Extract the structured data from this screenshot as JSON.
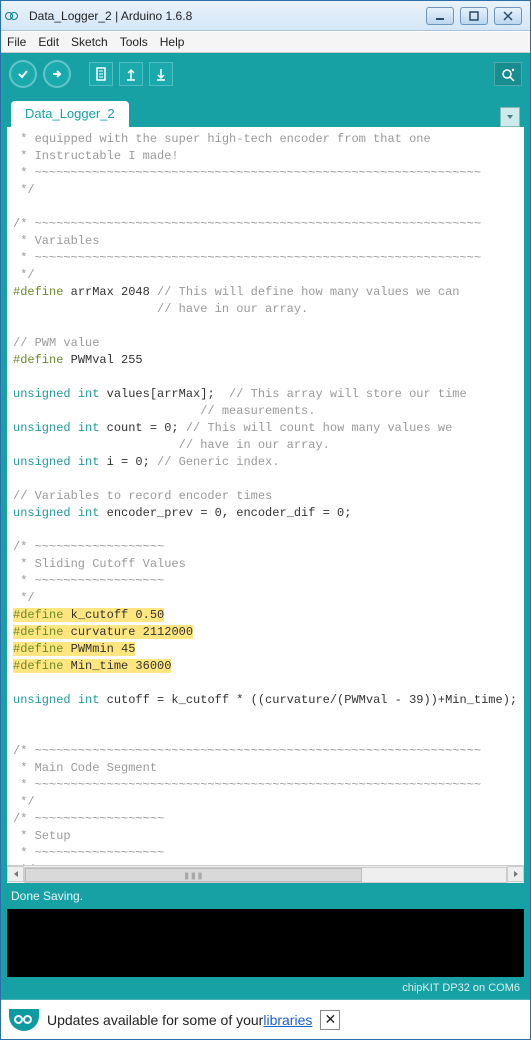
{
  "window": {
    "title": "Data_Logger_2 | Arduino 1.6.8"
  },
  "menu": {
    "file": "File",
    "edit": "Edit",
    "sketch": "Sketch",
    "tools": "Tools",
    "help": "Help"
  },
  "tabs": {
    "active": "Data_Logger_2"
  },
  "status": {
    "message": "Done Saving.",
    "board": "chipKIT DP32 on COM6"
  },
  "notification": {
    "prefix": "Updates available for some of your ",
    "link": "libraries"
  },
  "code": {
    "l1": " * equipped with the super high-tech encoder from that one",
    "l2": " * Instructable I made!",
    "l3": " * ~~~~~~~~~~~~~~~~~~~~~~~~~~~~~~~~~~~~~~~~~~~~~~~~~~~~~~~~~~~~~~",
    "l4": " */",
    "l5": "",
    "l6": "/* ~~~~~~~~~~~~~~~~~~~~~~~~~~~~~~~~~~~~~~~~~~~~~~~~~~~~~~~~~~~~~~",
    "l7": " * Variables",
    "l8": " * ~~~~~~~~~~~~~~~~~~~~~~~~~~~~~~~~~~~~~~~~~~~~~~~~~~~~~~~~~~~~~~",
    "l9": " */",
    "l10a": "#define",
    "l10b": " arrMax 2048 ",
    "l10c": "// This will define how many values we can",
    "l11": "                    // have in our array.",
    "l12": "",
    "l13": "// PWM value",
    "l14a": "#define",
    "l14b": " PWMval 255",
    "l15": "",
    "l16a": "unsigned",
    "l16b": " ",
    "l16c": "int",
    "l16d": " values[arrMax];  ",
    "l16e": "// This array will store our time",
    "l17": "                          // measurements.",
    "l18a": "unsigned",
    "l18b": " ",
    "l18c": "int",
    "l18d": " count = 0; ",
    "l18e": "// This will count how many values we",
    "l19": "                       // have in our array.",
    "l20a": "unsigned",
    "l20b": " ",
    "l20c": "int",
    "l20d": " i = 0; ",
    "l20e": "// Generic index.",
    "l21": "",
    "l22": "// Variables to record encoder times",
    "l23a": "unsigned",
    "l23b": " ",
    "l23c": "int",
    "l23d": " encoder_prev = 0, encoder_dif = 0;",
    "l24": "",
    "l25": "/* ~~~~~~~~~~~~~~~~~~",
    "l26": " * Sliding Cutoff Values",
    "l27": " * ~~~~~~~~~~~~~~~~~~",
    "l28": " */",
    "l29a": "#define",
    "l29b": " k_cutoff 0.50",
    "l30a": "#define",
    "l30b": " curvature 2112000",
    "l31a": "#define",
    "l31b": " PWMmin 45",
    "l32a": "#define",
    "l32b": " Min_time 36000",
    "l33": "",
    "l34a": "unsigned",
    "l34b": " ",
    "l34c": "int",
    "l34d": " cutoff = k_cutoff * ((curvature/(PWMval - 39))+Min_time);",
    "l35": "",
    "l36": "",
    "l37": "/* ~~~~~~~~~~~~~~~~~~~~~~~~~~~~~~~~~~~~~~~~~~~~~~~~~~~~~~~~~~~~~~",
    "l38": " * Main Code Segment",
    "l39": " * ~~~~~~~~~~~~~~~~~~~~~~~~~~~~~~~~~~~~~~~~~~~~~~~~~~~~~~~~~~~~~~",
    "l40": " */",
    "l41": "/* ~~~~~~~~~~~~~~~~~~",
    "l42": " * Setup",
    "l43": " * ~~~~~~~~~~~~~~~~~~",
    "l44": " */"
  }
}
